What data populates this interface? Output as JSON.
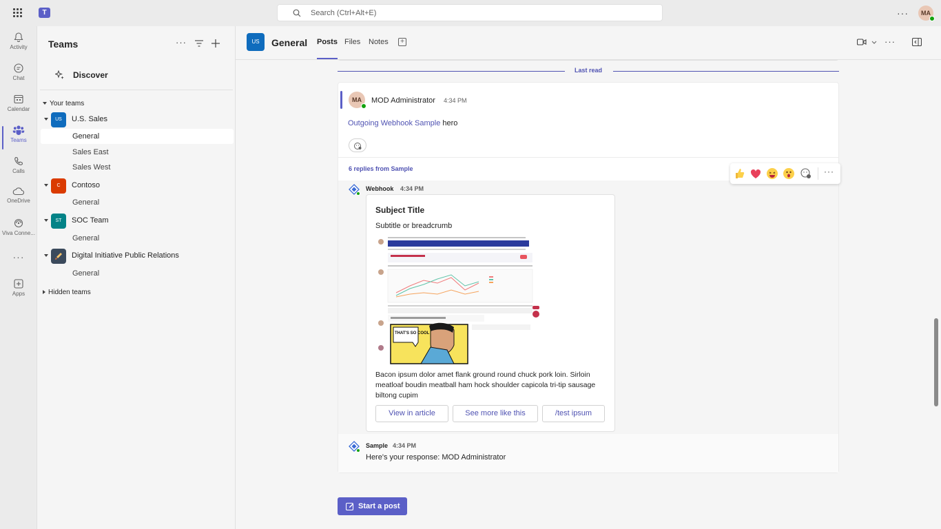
{
  "titlebar": {
    "search_placeholder": "Search (Ctrl+Alt+E)",
    "avatar_initials": "MA",
    "teams_glyph": "T"
  },
  "rail": [
    {
      "label": "Activity",
      "icon": "bell-icon"
    },
    {
      "label": "Chat",
      "icon": "chat-icon"
    },
    {
      "label": "Calendar",
      "icon": "calendar-icon"
    },
    {
      "label": "Teams",
      "icon": "teams-icon"
    },
    {
      "label": "Calls",
      "icon": "phone-icon"
    },
    {
      "label": "OneDrive",
      "icon": "cloud-icon"
    },
    {
      "label": "Viva Conne...",
      "icon": "viva-connections-icon"
    },
    {
      "label": "Apps",
      "icon": "apps-plus-icon"
    }
  ],
  "panel": {
    "title": "Teams",
    "discover_label": "Discover",
    "your_teams_label": "Your teams",
    "hidden_teams_label": "Hidden teams",
    "teams": [
      {
        "initials": "US",
        "name": "U.S. Sales",
        "color": "#0f6cbd",
        "channels": [
          "General",
          "Sales East",
          "Sales West"
        ]
      },
      {
        "initials": "C",
        "name": "Contoso",
        "color": "#da3b01",
        "channels": [
          "General"
        ]
      },
      {
        "initials": "ST",
        "name": "SOC Team",
        "color": "#038387",
        "channels": [
          "General"
        ]
      },
      {
        "initials": "",
        "name": "Digital Initiative Public Relations",
        "color": "#3b4a5c",
        "channels": [
          "General"
        ]
      }
    ]
  },
  "channel_header": {
    "team_initials": "US",
    "channel_name": "General",
    "tabs": [
      "Posts",
      "Files",
      "Notes"
    ]
  },
  "messages": {
    "last_read_label": "Last read",
    "root_post": {
      "avatar_initials": "MA",
      "author": "MOD Administrator",
      "time": "4:34 PM",
      "link_text": "Outgoing Webhook Sample",
      "body_suffix": " hero"
    },
    "replies_label": "6 replies from Sample",
    "webhook_reply": {
      "author": "Webhook",
      "time": "4:34 PM",
      "card": {
        "title": "Subject Title",
        "subtitle": "Subtitle or breadcrumb",
        "image_caption_text": "THAT'S SO COOL",
        "text": "Bacon ipsum dolor amet flank ground round chuck pork loin. Sirloin meatloaf boudin meatball ham hock shoulder capicola tri-tip sausage biltong cupim",
        "buttons": [
          "View in article",
          "See more like this",
          "/test ipsum"
        ]
      }
    },
    "sample_reply": {
      "author": "Sample",
      "time": "4:34 PM",
      "text": "Here's your response: MOD Administrator"
    }
  },
  "reactions": [
    "like-emoji",
    "heart-emoji",
    "laugh-emoji",
    "surprised-emoji"
  ],
  "start_post_label": "Start a post",
  "colors": {
    "accent": "#5b5fc7",
    "link": "#4f52b2",
    "presence": "#13a10e"
  }
}
